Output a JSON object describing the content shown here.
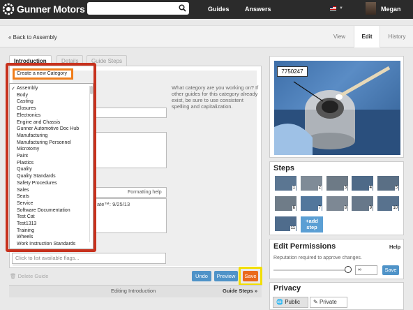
{
  "header": {
    "brand": "Gunner Motors",
    "search_placeholder": "",
    "nav": [
      "Guides",
      "Answers"
    ],
    "user_name": "Megan",
    "icons": [
      "gear-logo-icon",
      "search-icon",
      "us-flag-icon",
      "chevron-down-icon",
      "user-avatar"
    ]
  },
  "subnav": {
    "back_label": "« Back to Assembly",
    "tabs": [
      "View",
      "Edit",
      "History"
    ],
    "active_tab": "Edit"
  },
  "editor": {
    "tabs": [
      "Introduction",
      "Details",
      "Guide Steps"
    ],
    "active_tab": "Introduction",
    "help_text": "What category are you working on? If other guides for this category already exist, be sure to use consistent spelling and capitalization.",
    "formatting_help": "Formatting help",
    "date_text": "ate™: 9/25/13",
    "flags_placeholder": "Click to list available flags...",
    "delete_label": "Delete Guide",
    "buttons": {
      "undo": "Undo",
      "preview": "Preview",
      "save": "Save"
    },
    "footer": {
      "editing": "Editing Introduction",
      "guide_steps": "Guide Steps »"
    }
  },
  "category_dropdown": {
    "create_label": "Create a new Category",
    "selected": "Assembly",
    "items": [
      "Assembly",
      "Body",
      "Casting",
      "Closures",
      "Electronics",
      "Engine and Chassis",
      "Gunner Automotive Doc Hub",
      "Manufacturing",
      "Manufacturing Personnel",
      "Microtomy",
      "Paint",
      "Plastics",
      "Quality",
      "Quality Standards",
      "Safety Procedures",
      "Sales",
      "Seats",
      "Service",
      "Software Documentation",
      "Test Cat",
      "Test1313",
      "Training",
      "Wheels",
      "Work Instruction Standards"
    ],
    "highlight_color": "#c7311d",
    "create_highlight_color": "#f07d1a"
  },
  "sidebar": {
    "photo_label": "7750247",
    "steps_title": "Steps",
    "step_numbers": [
      "1",
      "2",
      "3",
      "4",
      "5",
      "6",
      "7",
      "8",
      "9",
      "10",
      "11"
    ],
    "add_step_label": "+add step",
    "permissions_title": "Edit Permissions",
    "permissions_help": "Help",
    "permissions_desc": "Reputation required to approve changes.",
    "permissions_value": "∞",
    "permissions_save": "Save",
    "privacy_title": "Privacy",
    "privacy_public": "Public",
    "privacy_private": "Private"
  },
  "colors": {
    "topbar": "#2b2b2b",
    "button_blue": "#4f93c8",
    "save_orange": "#ea6a1b",
    "save_highlight": "#f2de00"
  }
}
